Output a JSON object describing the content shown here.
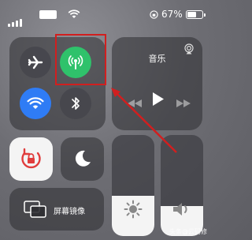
{
  "status_bar": {
    "battery_percent": "67%",
    "battery_level": 0.67
  },
  "music": {
    "title": "音乐"
  },
  "screen_mirroring": {
    "label": "屏幕镜像"
  },
  "brightness_level": 0.4,
  "volume_level": 0.3,
  "watermark": "头条@云码修",
  "colors": {
    "cellular_active": "#2fc26b",
    "wifi_active": "#2f7cf5",
    "annotation": "#d11f1f"
  }
}
